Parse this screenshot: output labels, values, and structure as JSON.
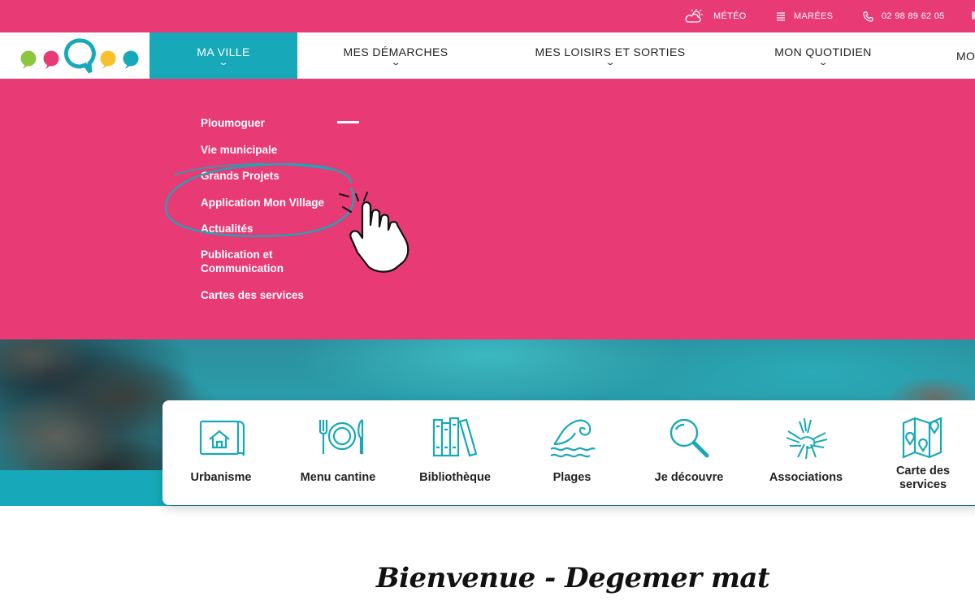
{
  "topbar": {
    "meteo_label": "MÉTÉO",
    "marees_label": "MARÉES",
    "phone": "02 98 89 62 05"
  },
  "nav": {
    "items": [
      {
        "label": "MA VILLE",
        "active": true
      },
      {
        "label": "MES DÉMARCHES"
      },
      {
        "label": "MES LOISIRS ET SORTIES"
      },
      {
        "label": "MON QUOTIDIEN"
      },
      {
        "label": "MO"
      }
    ]
  },
  "dropdown": {
    "links": [
      "Ploumoguer",
      "Vie municipale",
      "Grands Projets",
      "Application Mon Village",
      "Actualités",
      "Publication et Communication",
      "Cartes des services"
    ]
  },
  "quick_access": [
    {
      "label": "Urbanisme",
      "icon": "urbanism-house-icon"
    },
    {
      "label": "Menu cantine",
      "icon": "plate-cutlery-icon"
    },
    {
      "label": "Bibliothèque",
      "icon": "books-icon"
    },
    {
      "label": "Plages",
      "icon": "wave-icon"
    },
    {
      "label": "Je découvre",
      "icon": "magnifier-icon"
    },
    {
      "label": "Associations",
      "icon": "hands-icon"
    },
    {
      "label": "Carte des services",
      "icon": "map-pins-icon"
    }
  ],
  "welcome": {
    "title": "Bienvenue - Degemer mat"
  },
  "colors": {
    "pink": "#e83a74",
    "teal": "#17a9b9"
  }
}
